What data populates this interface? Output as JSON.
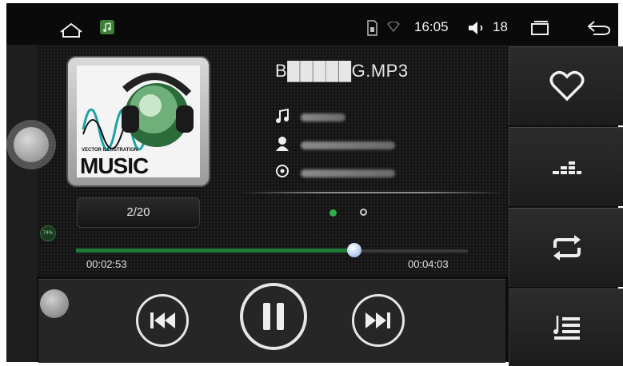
{
  "status_bar": {
    "icons": [
      "home-icon",
      "music-app-icon",
      "sd-card-icon",
      "wifi-icon",
      "volume-icon",
      "recent-apps-icon",
      "back-icon"
    ],
    "time": "16:05",
    "volume_level": "18"
  },
  "track": {
    "title": "B█████G.MP3",
    "album_art_text": "MUSIC",
    "album_art_subtext": "VECTOR ILLUSTRATION",
    "counter": "2/20",
    "meta_icons": [
      "music-note-icon",
      "person-icon",
      "disc-icon"
    ]
  },
  "playback": {
    "elapsed": "00:02:53",
    "total": "00:04:03",
    "progress": 0.71,
    "small_badge": "74%",
    "page_indicator": {
      "pages": 2,
      "active": 0
    }
  },
  "controls": {
    "buttons": [
      "previous-icon",
      "pause-icon",
      "next-icon"
    ]
  },
  "side_panel": {
    "buttons": [
      "favorite-icon",
      "equalizer-icon",
      "repeat-icon",
      "playlist-icon"
    ]
  },
  "colors": {
    "progress": "#1f7a37",
    "active_dot": "#2fae46",
    "background": "#141414"
  }
}
